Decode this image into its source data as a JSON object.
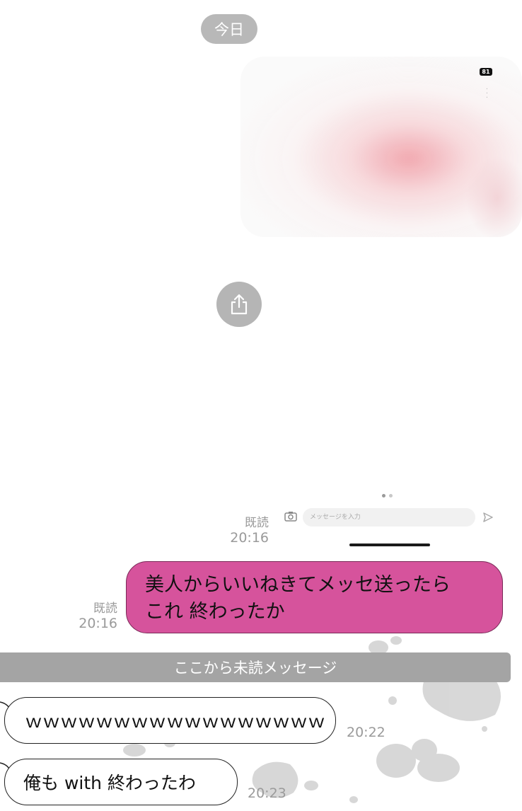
{
  "date_divider": "今日",
  "shared_image": {
    "badge": "81",
    "mini_input_placeholder": "メッセージを入力"
  },
  "messages_out": [
    {
      "read": "既読",
      "time": "20:16"
    },
    {
      "read": "既読",
      "time": "20:16",
      "text_line1": "美人からいいねきてメッセ送ったら",
      "text_line2": "これ 終わったか"
    }
  ],
  "unread_divider": "ここから未読メッセージ",
  "messages_in": [
    {
      "text": "ｗｗｗｗｗｗｗｗｗｗｗｗｗｗｗｗｗ",
      "time": "20:22"
    },
    {
      "text": "俺も with 終わったわ",
      "time": "20:23"
    }
  ],
  "colors": {
    "outgoing_bubble": "#d6539c",
    "unread_bar": "#a4a4a4",
    "date_pill": "#b8b8b8"
  }
}
